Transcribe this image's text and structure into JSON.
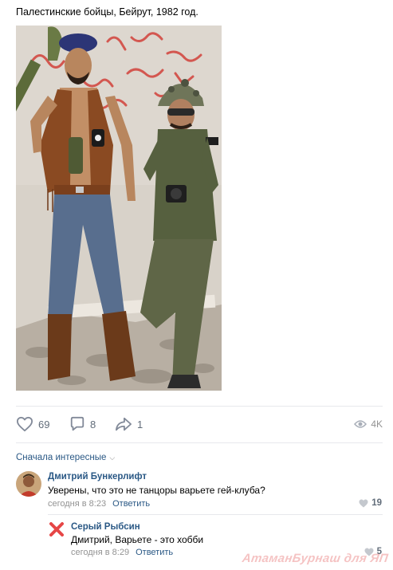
{
  "post": {
    "text": "Палестинские бойцы, Бейрут, 1982 год."
  },
  "actions": {
    "likes": "69",
    "comments": "8",
    "shares": "1",
    "views": "4K"
  },
  "comments_section": {
    "sort_label": "Сначала интересные"
  },
  "comments": [
    {
      "author": "Дмитрий Бункерлифт",
      "text": "Уверены, что это не танцоры варьете гей-клуба?",
      "time": "сегодня в 8:23",
      "reply_label": "Ответить",
      "likes": "19"
    },
    {
      "author": "Серый Рыбсин",
      "text": "Дмитрий, Варьете - это хобби",
      "time": "сегодня в 8:29",
      "reply_label": "Ответить",
      "likes": "5"
    }
  ],
  "watermark": "АтаманБурнаш для ЯП",
  "colors": {
    "link": "#2a5885",
    "muted": "#939393",
    "icon": "#828a99",
    "deleted_avatar": "#e64646"
  },
  "icons": {
    "like": "heart-icon",
    "comment": "comment-icon",
    "share": "share-icon",
    "views": "eye-icon"
  }
}
